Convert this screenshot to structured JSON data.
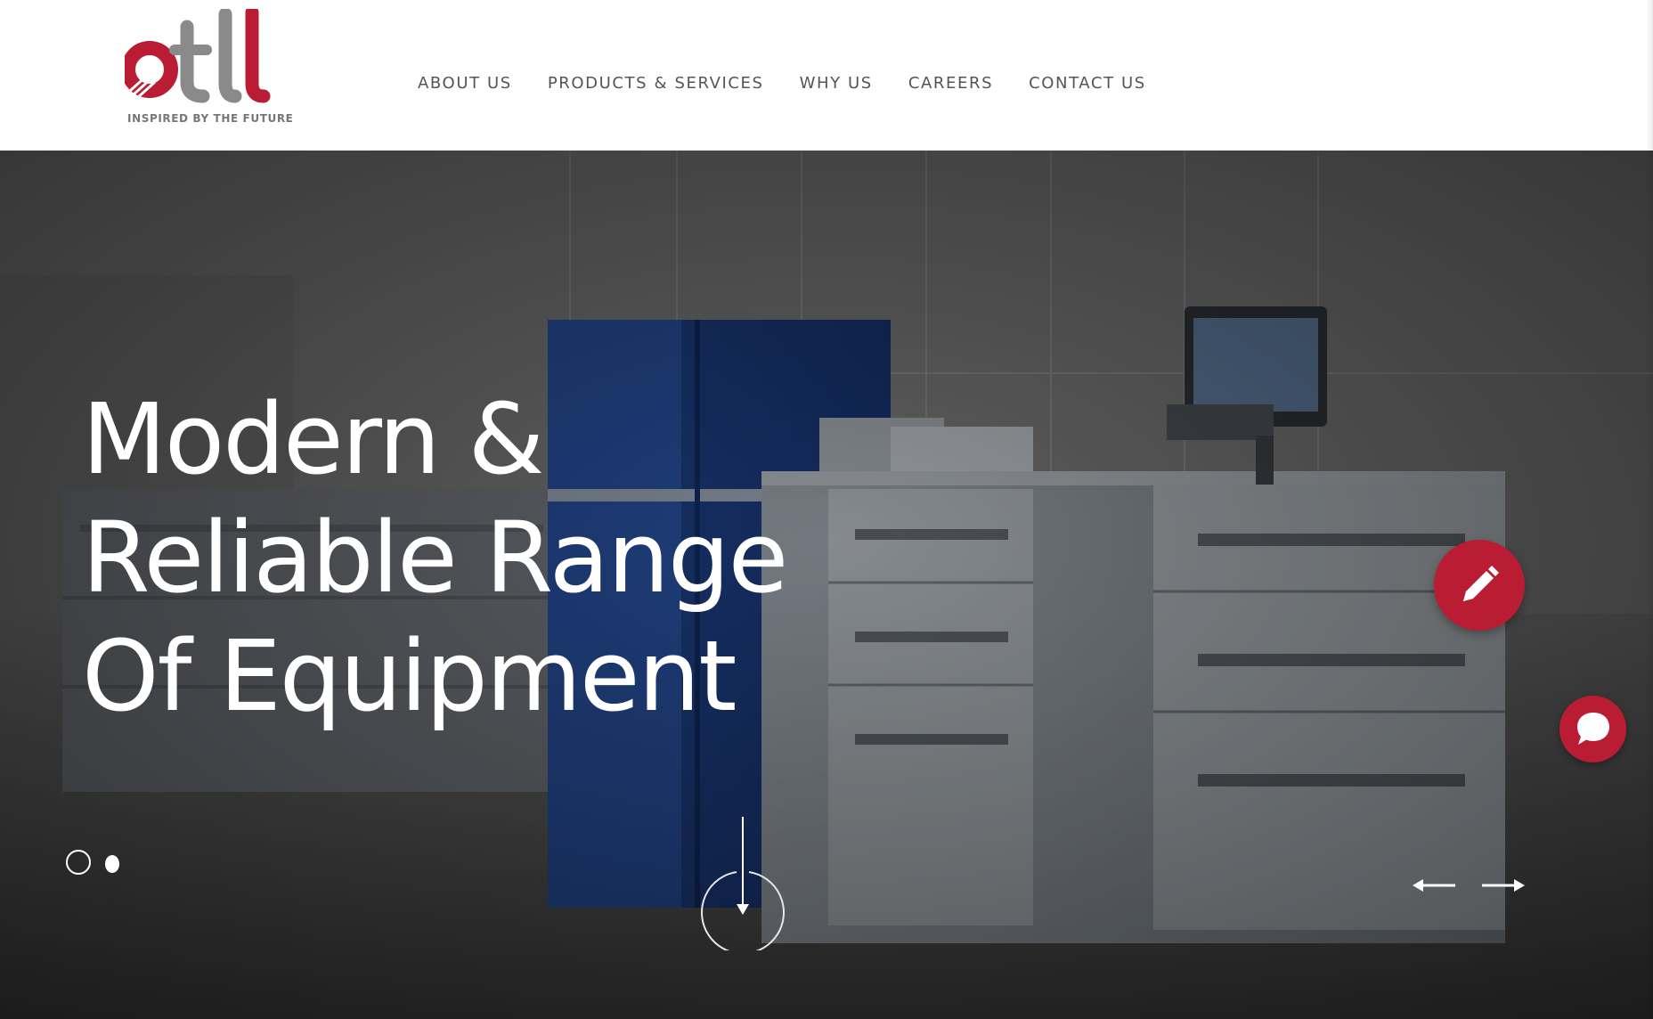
{
  "brand": {
    "tagline": "INSPIRED BY THE FUTURE",
    "logo_text": "otl",
    "accent_color": "#b91c33",
    "secondary_color": "#8a8a8a"
  },
  "nav": {
    "items": [
      {
        "label": "ABOUT US"
      },
      {
        "label": "PRODUCTS & SERVICES"
      },
      {
        "label": "WHY US"
      },
      {
        "label": "CAREERS"
      },
      {
        "label": "CONTACT US"
      }
    ]
  },
  "hero": {
    "title_lines": [
      "Modern &",
      "Reliable Range",
      "Of Equipment"
    ],
    "slide_count": 2,
    "active_slide": 1
  },
  "icons": {
    "scroll": "arrow-down-circle-icon",
    "prev": "arrow-left-icon",
    "next": "arrow-right-icon",
    "edit": "pencil-icon",
    "chat": "chat-bubble-icon"
  }
}
